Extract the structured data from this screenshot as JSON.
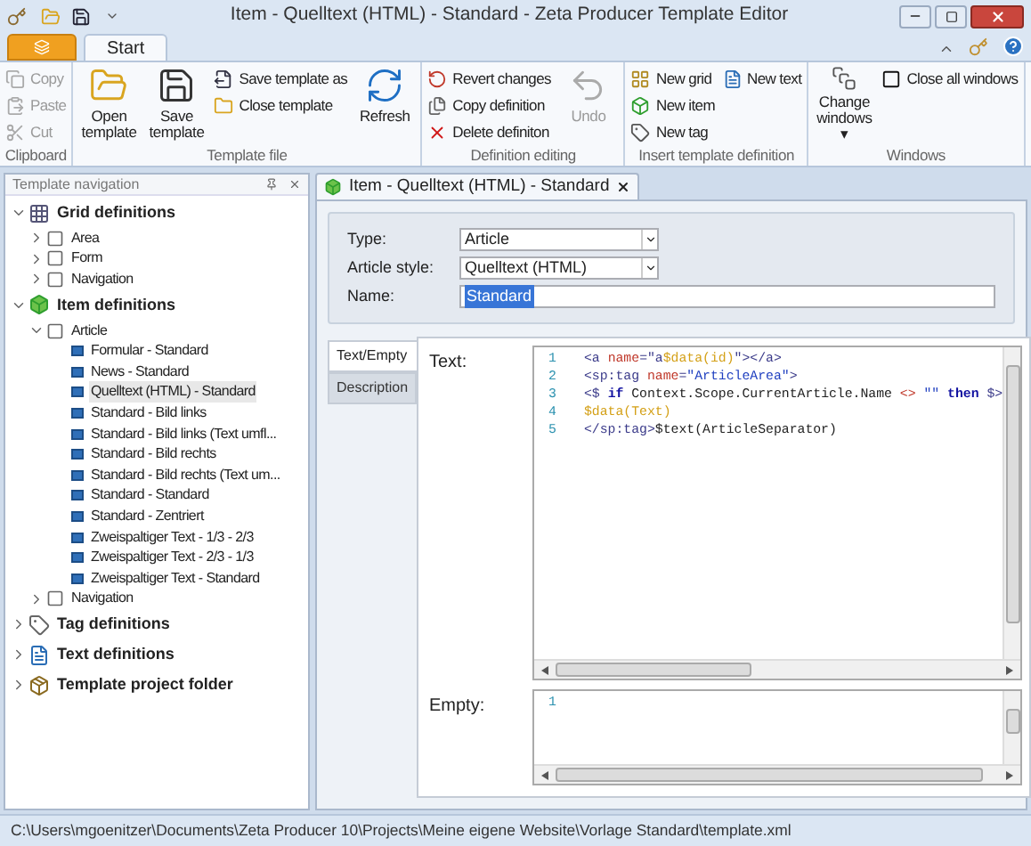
{
  "window": {
    "title": "Item - Quelltext (HTML) - Standard - Zeta Producer Template Editor"
  },
  "ribbon_tabs": [
    {
      "label": "Start",
      "selected": true
    }
  ],
  "ribbon_groups": [
    {
      "title": "Clipboard",
      "buttons": [
        {
          "label": "Copy",
          "kind": "small",
          "disabled": true
        },
        {
          "label": "Paste",
          "kind": "small",
          "disabled": true
        },
        {
          "label": "Cut",
          "kind": "small",
          "disabled": true
        }
      ]
    },
    {
      "title": "Template file",
      "buttons": [
        {
          "label": "Open template",
          "kind": "large",
          "disabled": false
        },
        {
          "label": "Save template",
          "kind": "large",
          "disabled": false
        },
        {
          "label": "Save template as",
          "kind": "small",
          "disabled": false
        },
        {
          "label": "Close template",
          "kind": "small",
          "disabled": false
        },
        {
          "label": "Refresh",
          "kind": "large",
          "disabled": false
        }
      ]
    },
    {
      "title": "Definition editing",
      "buttons": [
        {
          "label": "Revert changes",
          "kind": "small",
          "disabled": false
        },
        {
          "label": "Copy definition",
          "kind": "small",
          "disabled": false
        },
        {
          "label": "Delete definiton",
          "kind": "small",
          "disabled": false
        },
        {
          "label": "Undo",
          "kind": "large",
          "disabled": true
        }
      ]
    },
    {
      "title": "Insert template definition",
      "buttons": [
        {
          "label": "New grid",
          "kind": "small",
          "disabled": false
        },
        {
          "label": "New item",
          "kind": "small",
          "disabled": false
        },
        {
          "label": "New tag",
          "kind": "small",
          "disabled": false
        },
        {
          "label": "New text",
          "kind": "small",
          "disabled": false
        }
      ]
    },
    {
      "title": "Windows",
      "buttons": [
        {
          "label": "Change windows ▾",
          "kind": "large",
          "disabled": false
        },
        {
          "label": "Close all windows",
          "kind": "small",
          "disabled": false
        }
      ]
    }
  ],
  "navigation": {
    "title": "Template navigation",
    "tree": [
      {
        "label": "Grid definitions",
        "kind": "grids",
        "expanded": true,
        "selected": false,
        "children": [
          {
            "label": "Area",
            "kind": "group",
            "expanded": false,
            "selected": false
          },
          {
            "label": "Form",
            "kind": "group",
            "expanded": false,
            "selected": false
          },
          {
            "label": "Navigation",
            "kind": "group",
            "expanded": false,
            "selected": false
          }
        ]
      },
      {
        "label": "Item definitions",
        "kind": "items",
        "expanded": true,
        "selected": false,
        "children": [
          {
            "label": "Article",
            "kind": "group",
            "expanded": true,
            "selected": false,
            "children": [
              {
                "label": "Formular - Standard",
                "kind": "template",
                "selected": false
              },
              {
                "label": "News - Standard",
                "kind": "template",
                "selected": false
              },
              {
                "label": "Quelltext (HTML) - Standard",
                "kind": "template",
                "selected": true
              },
              {
                "label": "Standard - Bild links",
                "kind": "template",
                "selected": false
              },
              {
                "label": "Standard - Bild links (Text umfl...",
                "kind": "template",
                "selected": false
              },
              {
                "label": "Standard - Bild rechts",
                "kind": "template",
                "selected": false
              },
              {
                "label": "Standard - Bild rechts (Text um...",
                "kind": "template",
                "selected": false
              },
              {
                "label": "Standard - Standard",
                "kind": "template",
                "selected": false
              },
              {
                "label": "Standard - Zentriert",
                "kind": "template",
                "selected": false
              },
              {
                "label": "Zweispaltiger Text - 1/3 - 2/3",
                "kind": "template",
                "selected": false
              },
              {
                "label": "Zweispaltiger Text - 2/3 - 1/3",
                "kind": "template",
                "selected": false
              },
              {
                "label": "Zweispaltiger Text - Standard",
                "kind": "template",
                "selected": false
              }
            ]
          },
          {
            "label": "Navigation",
            "kind": "group",
            "expanded": false,
            "selected": false
          }
        ]
      },
      {
        "label": "Tag definitions",
        "kind": "tags",
        "expanded": false,
        "selected": false
      },
      {
        "label": "Text definitions",
        "kind": "texts",
        "expanded": false,
        "selected": false
      },
      {
        "label": "Template project folder",
        "kind": "project",
        "expanded": false,
        "selected": false
      }
    ]
  },
  "document_tab": {
    "title": "Item - Quelltext (HTML) - Standard",
    "selected": true
  },
  "form": [
    {
      "label": "Type:",
      "kind": "dropdown",
      "value": "Article"
    },
    {
      "label": "Article style:",
      "kind": "dropdown",
      "value": "Quelltext (HTML)"
    },
    {
      "label": "Name:",
      "kind": "text",
      "value": "Standard"
    }
  ],
  "side_tabs": [
    {
      "label": "Text/Empty",
      "selected": true
    },
    {
      "label": "Description",
      "selected": false
    }
  ],
  "editors": [
    {
      "label": "Text:",
      "lines": [
        {
          "number": "1",
          "segments": [
            {
              "kind": "tag",
              "text": "<a "
            },
            {
              "kind": "attr",
              "text": "name"
            },
            {
              "kind": "tag",
              "text": "=\"a"
            },
            {
              "kind": "var",
              "text": "$data(id)"
            },
            {
              "kind": "tag",
              "text": "\"></a>"
            }
          ]
        },
        {
          "number": "2",
          "segments": [
            {
              "kind": "tag",
              "text": "<sp:tag "
            },
            {
              "kind": "attr",
              "text": "name"
            },
            {
              "kind": "tag",
              "text": "="
            },
            {
              "kind": "string",
              "text": "\"ArticleArea\""
            },
            {
              "kind": "tag",
              "text": ">"
            }
          ]
        },
        {
          "number": "3",
          "segments": [
            {
              "kind": "tag",
              "text": "<$ "
            },
            {
              "kind": "keyword",
              "text": "if"
            },
            {
              "kind": "plain",
              "text": " Context.Scope.CurrentArticle.Name "
            },
            {
              "kind": "attr",
              "text": "<>"
            },
            {
              "kind": "string",
              "text": " \"\" "
            },
            {
              "kind": "keyword",
              "text": "then"
            },
            {
              "kind": "tag",
              "text": " $>"
            }
          ]
        },
        {
          "number": "4",
          "segments": [
            {
              "kind": "var",
              "text": "$data(Text)"
            }
          ]
        },
        {
          "number": "5",
          "segments": [
            {
              "kind": "tag",
              "text": "</sp:tag>"
            },
            {
              "kind": "plain",
              "text": "$text(ArticleSeparator)"
            }
          ]
        }
      ]
    },
    {
      "label": "Empty:",
      "lines": [
        {
          "number": "1"
        }
      ]
    }
  ],
  "status_bar": {
    "path": "C:\\Users\\mgoenitzer\\Documents\\Zeta Producer 10\\Projects\\Meine eigene Website\\Vorlage Standard\\template.xml"
  }
}
